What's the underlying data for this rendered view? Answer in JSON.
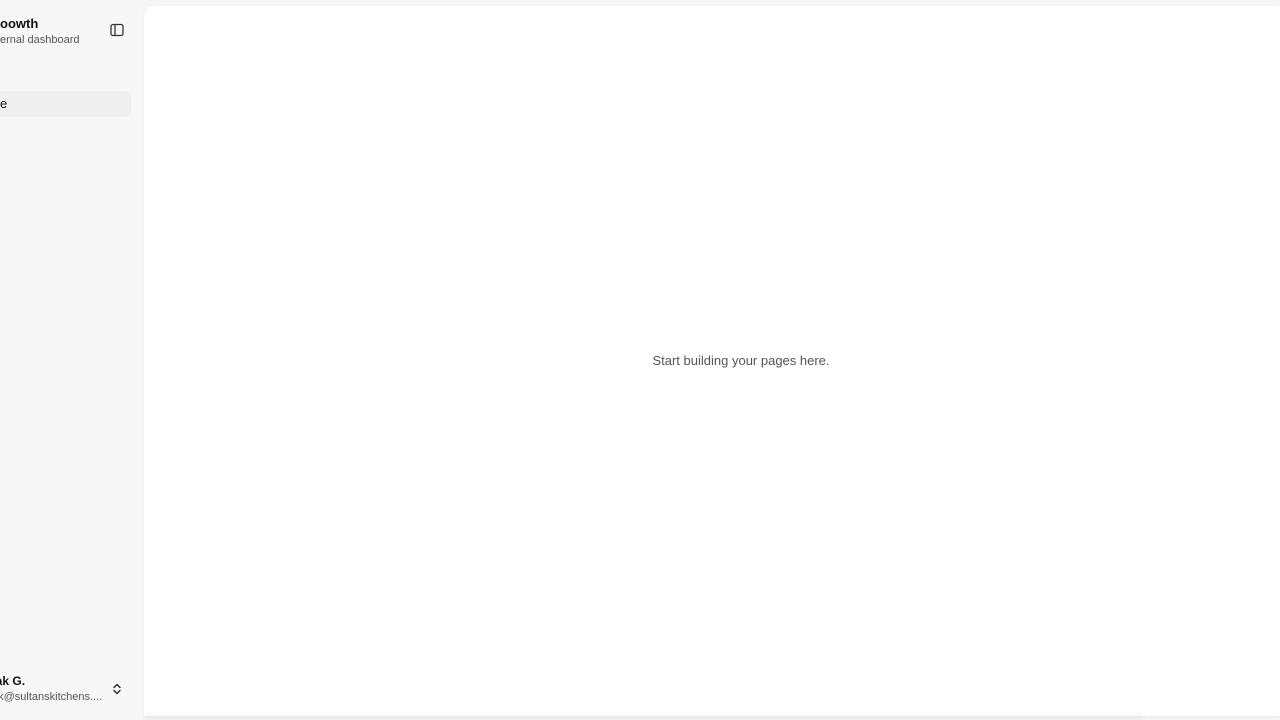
{
  "sidebar": {
    "brand": {
      "name": "oowth",
      "subtitle": "ernal dashboard"
    },
    "toggle_icon": "sidebar-panel-icon",
    "nav_items": [
      {
        "label": "e",
        "active": true
      }
    ],
    "user": {
      "name": "aak G.",
      "email": "ak@sultanskitchens....",
      "chevron_icon": "chevron-up-down-icon"
    }
  },
  "main": {
    "empty_message": "Start building your pages here."
  }
}
